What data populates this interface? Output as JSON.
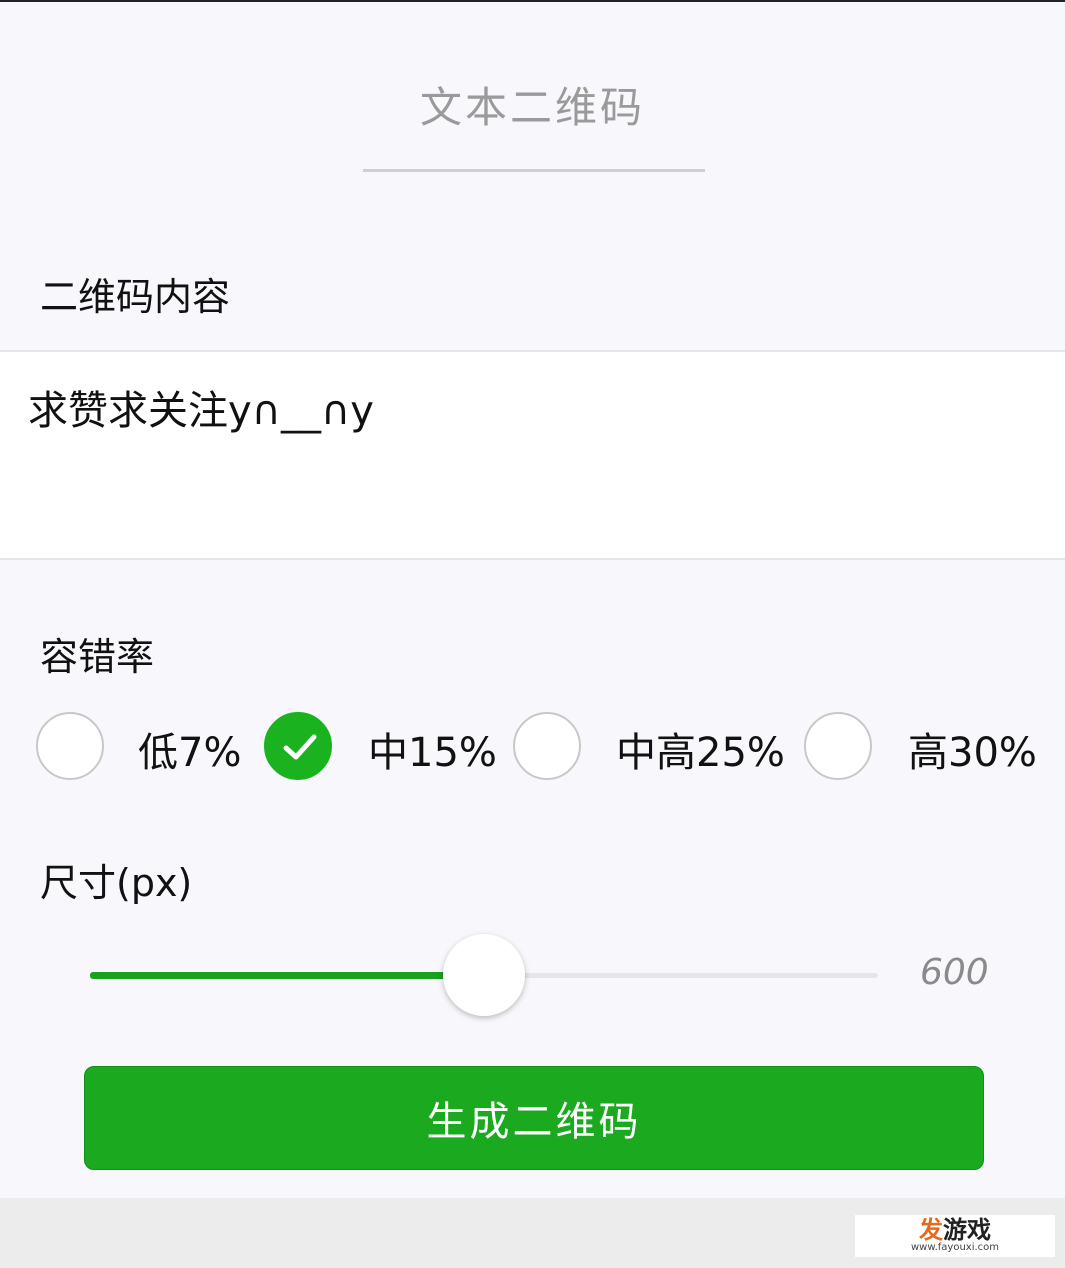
{
  "page": {
    "title": "文本二维码"
  },
  "content_section": {
    "label": "二维码内容",
    "value": "求赞求关注y∩__∩y"
  },
  "error_correction": {
    "label": "容错率",
    "options": [
      {
        "label": "低7%",
        "checked": false
      },
      {
        "label": "中15%",
        "checked": true
      },
      {
        "label": "中高25%",
        "checked": false
      },
      {
        "label": "高30%",
        "checked": false
      }
    ]
  },
  "size": {
    "label": "尺寸(px)",
    "value": "600",
    "slider_fraction": 0.5
  },
  "generate_button": {
    "label": "生成二维码"
  },
  "watermark": {
    "accent_char": "发",
    "main_rest": "游戏",
    "url": "www.fayouxi.com"
  },
  "colors": {
    "accent": "#1ab31f",
    "background": "#f8f7fb"
  }
}
